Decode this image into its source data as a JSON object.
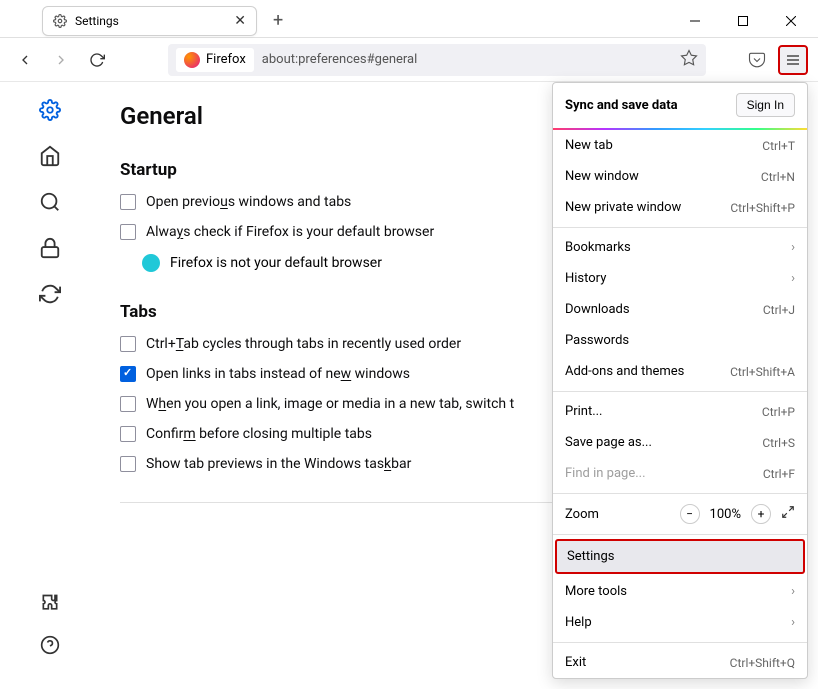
{
  "tab": {
    "title": "Settings"
  },
  "urlbar": {
    "identity": "Firefox",
    "url": "about:preferences#general"
  },
  "page": {
    "title": "General"
  },
  "startup": {
    "title": "Startup",
    "open_previous": "Open previous windows and tabs",
    "always_check": "Always check if Firefox is your default browser",
    "not_default": "Firefox is not your default browser"
  },
  "tabs": {
    "title": "Tabs",
    "ctrltab": "Ctrl+Tab cycles through tabs in recently used order",
    "openlinks": "Open links in tabs instead of new windows",
    "switchto": "When you open a link, image or media in a new tab, switch t",
    "confirm": "Confirm before closing multiple tabs",
    "showprev": "Show tab previews in the Windows taskbar"
  },
  "menu": {
    "sync_title": "Sync and save data",
    "signin": "Sign In",
    "newtab": {
      "label": "New tab",
      "shortcut": "Ctrl+T"
    },
    "newwindow": {
      "label": "New window",
      "shortcut": "Ctrl+N"
    },
    "newprivate": {
      "label": "New private window",
      "shortcut": "Ctrl+Shift+P"
    },
    "bookmarks": {
      "label": "Bookmarks"
    },
    "history": {
      "label": "History"
    },
    "downloads": {
      "label": "Downloads",
      "shortcut": "Ctrl+J"
    },
    "passwords": {
      "label": "Passwords"
    },
    "addons": {
      "label": "Add-ons and themes",
      "shortcut": "Ctrl+Shift+A"
    },
    "print": {
      "label": "Print...",
      "shortcut": "Ctrl+P"
    },
    "savepage": {
      "label": "Save page as...",
      "shortcut": "Ctrl+S"
    },
    "findinpage": {
      "label": "Find in page...",
      "shortcut": "Ctrl+F"
    },
    "zoom": {
      "label": "Zoom",
      "value": "100%"
    },
    "settings": {
      "label": "Settings"
    },
    "moretools": {
      "label": "More tools"
    },
    "help": {
      "label": "Help"
    },
    "exit": {
      "label": "Exit",
      "shortcut": "Ctrl+Shift+Q"
    }
  }
}
